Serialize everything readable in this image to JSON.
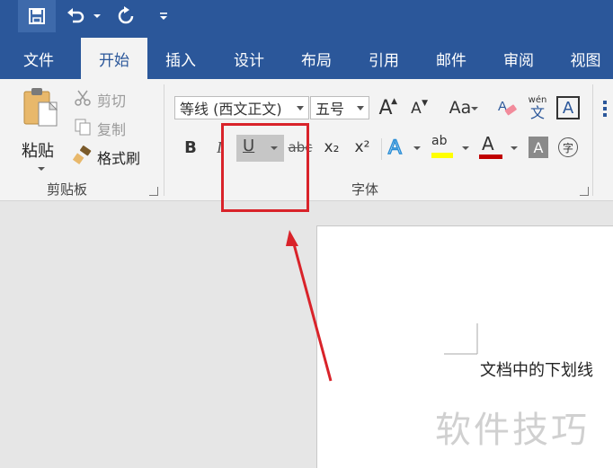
{
  "quick_access": {
    "save_icon": "save-icon",
    "undo_icon": "undo-icon",
    "redo_icon": "redo-icon",
    "customize_icon": "customize-quick-access-icon"
  },
  "tabs": [
    {
      "label": "文件"
    },
    {
      "label": "开始",
      "active": true
    },
    {
      "label": "插入"
    },
    {
      "label": "设计"
    },
    {
      "label": "布局"
    },
    {
      "label": "引用"
    },
    {
      "label": "邮件"
    },
    {
      "label": "审阅"
    },
    {
      "label": "视图"
    }
  ],
  "clipboard": {
    "paste_label": "粘贴",
    "cut_label": "剪切",
    "copy_label": "复制",
    "format_painter_label": "格式刷",
    "group_label": "剪贴板"
  },
  "font": {
    "font_name": "等线 (西文正文)",
    "font_size": "五号",
    "group_label": "字体",
    "change_case_label": "Aa",
    "bold_label": "B",
    "italic_label": "I",
    "underline_label": "U",
    "strike_label": "abc",
    "subscript_label": "x₂",
    "superscript_label": "x²",
    "phonetic_label": "wén",
    "phonetic_char": "文",
    "enclose_char": "字",
    "highlight_label": "ab",
    "font_color_label": "A",
    "grow_label": "A",
    "shrink_label": "A",
    "border_label": "A",
    "shading_label": "A",
    "effects_label": "A",
    "colors": {
      "highlight": "#ffff00",
      "font_color": "#c00000",
      "accent": "#2b579a"
    }
  },
  "document": {
    "text": "文档中的下划线",
    "watermark": "软件技巧"
  },
  "annotation": {
    "box_color": "#d9232a"
  }
}
